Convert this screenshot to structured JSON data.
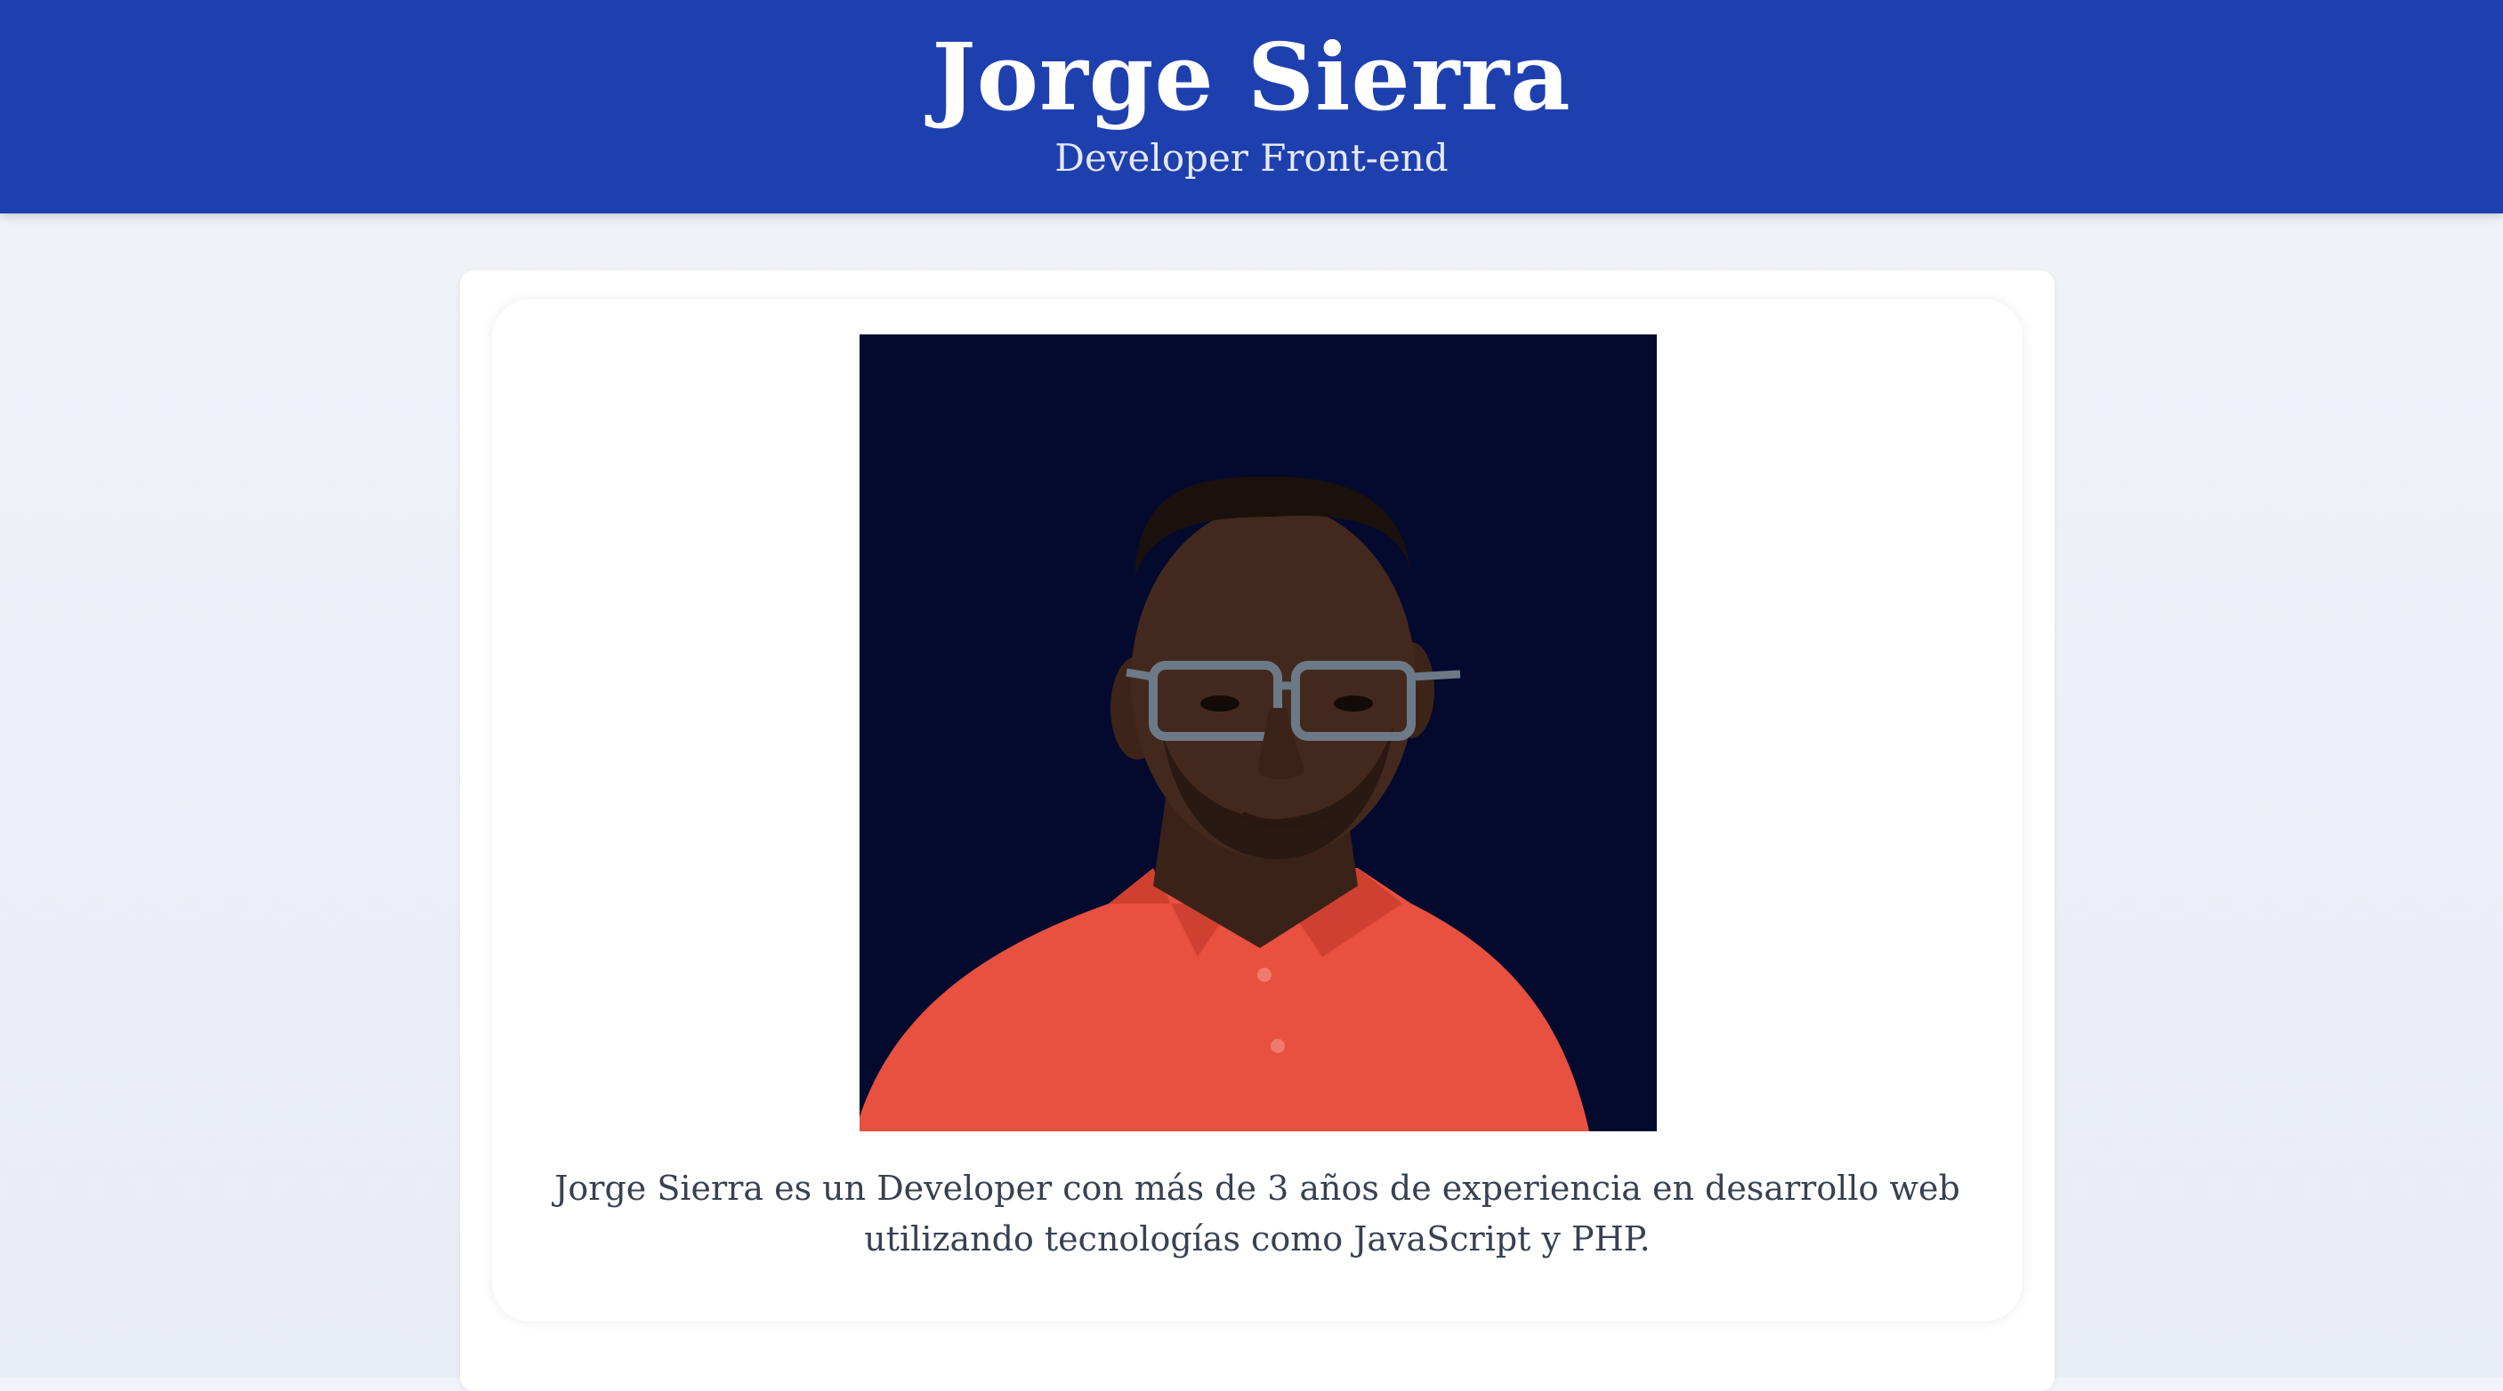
{
  "header": {
    "name": "Jorge Sierra",
    "role": "Developer Front-end"
  },
  "profile": {
    "photo_icon": "portrait-photo",
    "bio": "Jorge Sierra es un Developer con más de 3 años de experiencia en desarrollo web utilizando tecnologías como JavaScript y PHP."
  },
  "colors": {
    "header_bg": "#1e40af",
    "photo_bg": "#040a2e",
    "shirt": "#e8503f",
    "page_bg": "#eef1f6"
  }
}
